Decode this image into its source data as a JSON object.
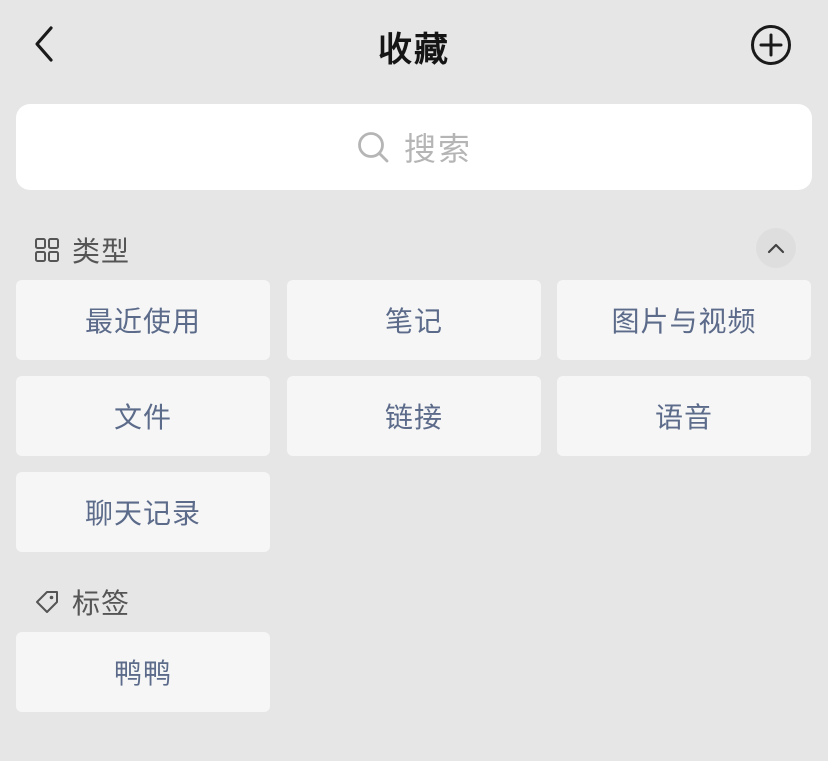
{
  "header": {
    "title": "收藏",
    "back_icon": "chevron-left-icon",
    "add_icon": "plus-circle-icon"
  },
  "search": {
    "placeholder": "搜索",
    "icon": "search-icon"
  },
  "types_section": {
    "title": "类型",
    "icon": "grid-icon",
    "collapse_icon": "chevron-up-icon",
    "items": [
      {
        "label": "最近使用"
      },
      {
        "label": "笔记"
      },
      {
        "label": "图片与视频"
      },
      {
        "label": "文件"
      },
      {
        "label": "链接"
      },
      {
        "label": "语音"
      },
      {
        "label": "聊天记录"
      }
    ]
  },
  "tags_section": {
    "title": "标签",
    "icon": "tag-icon",
    "items": [
      {
        "label": "鸭鸭"
      }
    ]
  },
  "colors": {
    "background": "#e6e6e7",
    "tile": "#f6f6f7",
    "tile_text": "#5c6b8a",
    "search_bg": "#ffffff"
  }
}
